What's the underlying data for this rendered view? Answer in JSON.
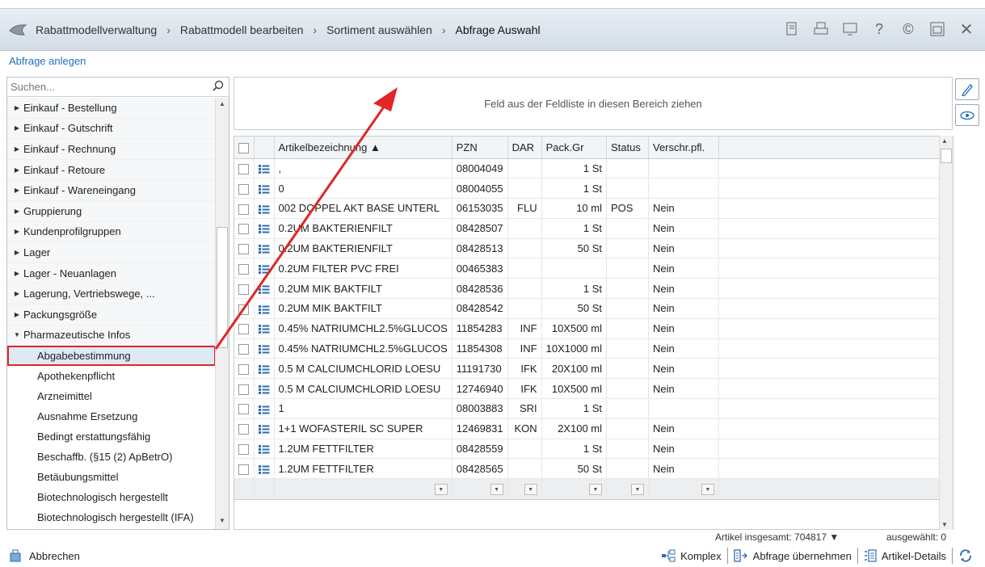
{
  "breadcrumb": [
    "Rabattmodellverwaltung",
    "Rabattmodell bearbeiten",
    "Sortiment auswählen",
    "Abfrage Auswahl"
  ],
  "titlebar_icons": [
    "document-icon",
    "print-icon",
    "monitor-icon",
    "help-icon",
    "euro-icon",
    "window-icon",
    "close-icon"
  ],
  "subbar": {
    "link": "Abfrage anlegen"
  },
  "search": {
    "placeholder": "Suchen..."
  },
  "tree": {
    "groups": [
      "Einkauf - Bestellung",
      "Einkauf - Gutschrift",
      "Einkauf - Rechnung",
      "Einkauf - Retoure",
      "Einkauf - Wareneingang",
      "Gruppierung",
      "Kundenprofilgruppen",
      "Lager",
      "Lager - Neuanlagen",
      "Lagerung, Vertriebswege, ...",
      "Packungsgröße"
    ],
    "expanded_group": "Pharmazeutische Infos",
    "leaves": [
      "Abgabebestimmung",
      "Apothekenpflicht",
      "Arzneimittel",
      "Ausnahme Ersetzung",
      "Bedingt erstattungsfähig",
      "Beschaffb. (§15 (2) ApBetrO)",
      "Betäubungsmittel",
      "Biotechnologisch hergestellt",
      "Biotechnologisch hergestellt (IFA)"
    ],
    "selected_leaf": "Abgabebestimmung"
  },
  "dropzone": {
    "text": "Feld aus der Feldliste in diesen Bereich ziehen"
  },
  "grid": {
    "headers": [
      "Artikelbezeichnung ▲",
      "PZN",
      "DAR",
      "Pack.Gr",
      "Status",
      "Verschr.pfl."
    ],
    "rows": [
      [
        ",",
        "08004049",
        "",
        "1 St",
        "",
        ""
      ],
      [
        "0",
        "08004055",
        "",
        "1 St",
        "",
        ""
      ],
      [
        "002 DOPPEL AKT BASE UNTERL",
        "06153035",
        "FLU",
        "10 ml",
        "POS",
        "Nein"
      ],
      [
        "0.2UM BAKTERIENFILT",
        "08428507",
        "",
        "1 St",
        "",
        "Nein"
      ],
      [
        "0.2UM BAKTERIENFILT",
        "08428513",
        "",
        "50 St",
        "",
        "Nein"
      ],
      [
        "0.2UM FILTER PVC FREI",
        "00465383",
        "",
        "",
        "",
        "Nein"
      ],
      [
        "0.2UM MIK BAKTFILT",
        "08428536",
        "",
        "1 St",
        "",
        "Nein"
      ],
      [
        "0.2UM MIK BAKTFILT",
        "08428542",
        "",
        "50 St",
        "",
        "Nein"
      ],
      [
        "0.45% NATRIUMCHL2.5%GLUCOS",
        "11854283",
        "INF",
        "10X500 ml",
        "",
        "Nein"
      ],
      [
        "0.45% NATRIUMCHL2.5%GLUCOS",
        "11854308",
        "INF",
        "10X1000 ml",
        "",
        "Nein"
      ],
      [
        "0.5 M CALCIUMCHLORID LOESU",
        "11191730",
        "IFK",
        "20X100 ml",
        "",
        "Nein"
      ],
      [
        "0.5 M CALCIUMCHLORID LOESU",
        "12746940",
        "IFK",
        "10X500 ml",
        "",
        "Nein"
      ],
      [
        "1",
        "08003883",
        "SRI",
        "1 St",
        "",
        ""
      ],
      [
        "1+1 WOFASTERIL SC SUPER",
        "12469831",
        "KON",
        "2X100 ml",
        "",
        "Nein"
      ],
      [
        "1.2UM FETTFILTER",
        "08428559",
        "",
        "1 St",
        "",
        "Nein"
      ],
      [
        "1.2UM FETTFILTER",
        "08428565",
        "",
        "50 St",
        "",
        "Nein"
      ]
    ]
  },
  "status": {
    "total": "Artikel insgesamt: 704817 ▼",
    "selected": "ausgewählt: 0"
  },
  "footer": {
    "cancel": "Abbrechen",
    "komplex": "Komplex",
    "uebernehmen": "Abfrage übernehmen",
    "details": "Artikel-Details"
  },
  "colors": {
    "link": "#1f6fc1",
    "selection_border": "#e02626",
    "arrow": "#e02626",
    "titlebar": "#dfe6ee"
  }
}
